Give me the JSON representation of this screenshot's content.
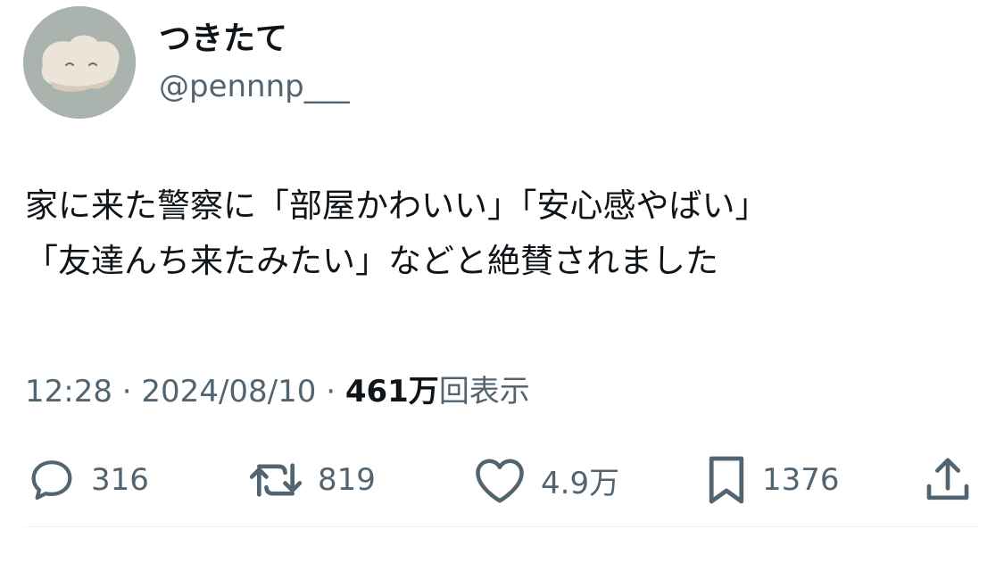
{
  "user": {
    "display_name": "つきたて",
    "handle": "@pennnp___",
    "avatar_icon": "mochi-avatar-icon"
  },
  "tweet": {
    "text_lines": [
      "家に来た警察に「部屋かわいい」「安心感やばい」",
      "「友達んち来たみたい」などと絶賛されました"
    ]
  },
  "meta": {
    "time": "12:28",
    "separator": "·",
    "date": "2024/08/10",
    "views_count": "461万",
    "views_label": "回表示"
  },
  "actions": {
    "reply": {
      "icon": "reply-icon",
      "count": "316"
    },
    "retweet": {
      "icon": "retweet-icon",
      "count": "819"
    },
    "like": {
      "icon": "heart-icon",
      "count": "4.9万"
    },
    "bookmark": {
      "icon": "bookmark-icon",
      "count": "1376"
    },
    "share": {
      "icon": "share-icon"
    }
  },
  "colors": {
    "text_primary": "#0f1419",
    "text_secondary": "#536471",
    "avatar_bg": "#aab3ad",
    "divider": "#eff3f4"
  }
}
